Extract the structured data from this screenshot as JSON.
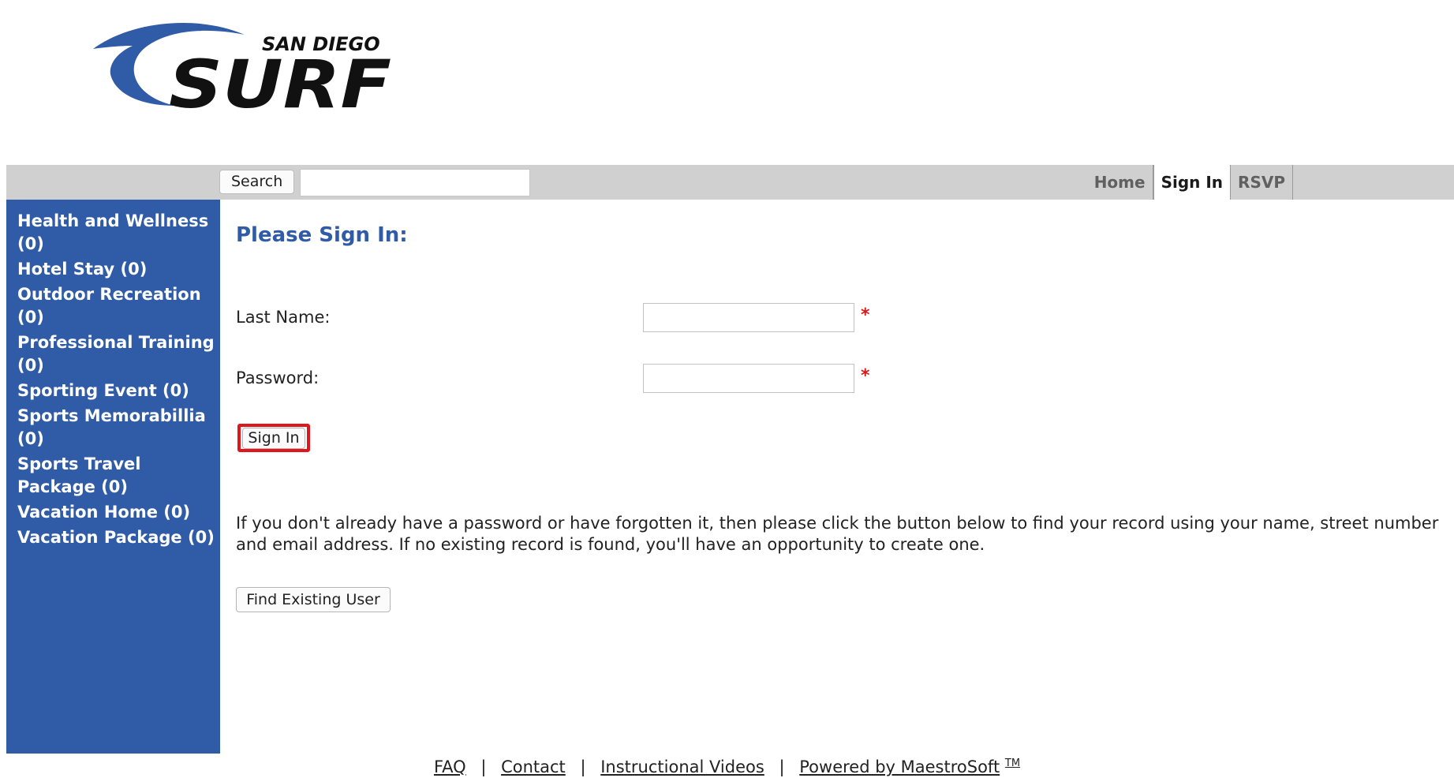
{
  "logo": {
    "small_text": "SAN DIEGO",
    "big_text": "SURF"
  },
  "navbar": {
    "search_label": "Search",
    "search_value": "",
    "tabs": [
      {
        "label": "Home",
        "active": false
      },
      {
        "label": "Sign In",
        "active": true
      },
      {
        "label": "RSVP",
        "active": false
      }
    ]
  },
  "sidebar": {
    "items": [
      "Health and Wellness (0)",
      "Hotel Stay (0)",
      "Outdoor Recreation (0)",
      "Professional Training (0)",
      "Sporting Event (0)",
      "Sports Memorabillia (0)",
      "Sports Travel Package (0)",
      "Vacation Home (0)",
      "Vacation Package (0)"
    ]
  },
  "main": {
    "title": "Please Sign In:",
    "last_name_label": "Last Name:",
    "last_name_value": "",
    "password_label": "Password:",
    "password_value": "",
    "required_mark": "*",
    "sign_in_button": "Sign In",
    "info_text": "If you don't already have a password or have forgotten it, then please click the button below to find your record using your name, street number and email address. If no existing record is found, you'll have an opportunity to create one.",
    "find_user_button": "Find Existing User"
  },
  "footer": {
    "faq": "FAQ",
    "contact": "Contact",
    "videos": "Instructional Videos",
    "powered": "Powered by MaestroSoft",
    "tm": "TM",
    "separator": "|"
  },
  "colors": {
    "brand_blue": "#2f5ba7",
    "navbar_gray": "#d0d0d0",
    "required_red": "#d21c1c",
    "highlight_red": "#e0161c"
  }
}
